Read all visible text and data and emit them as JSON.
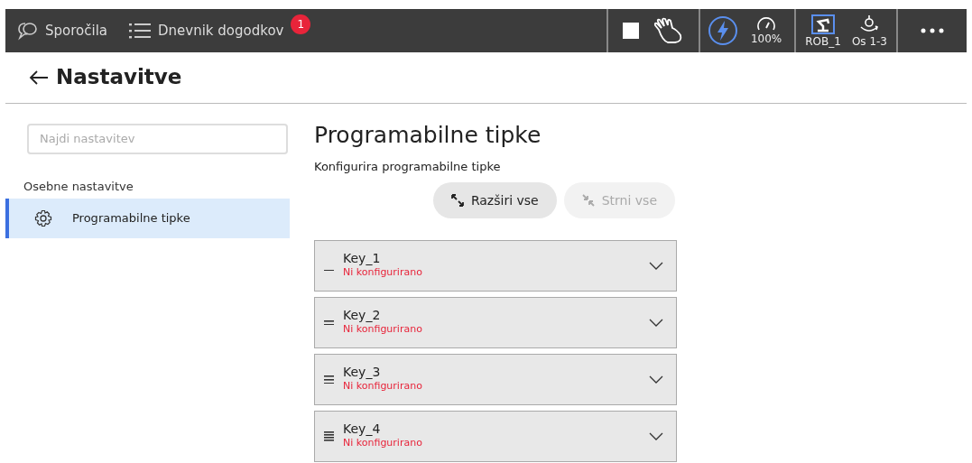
{
  "top_bar": {
    "messages": {
      "label": "Sporočila"
    },
    "event_log": {
      "label": "Dnevnik dogodkov",
      "badge": "1"
    },
    "speed": {
      "reading": "100%"
    },
    "robot": {
      "label": "ROB_1"
    },
    "axes": {
      "label": "Os 1-3"
    }
  },
  "page": {
    "title": "Nastavitve"
  },
  "sidebar": {
    "search": {
      "placeholder": "Najdi nastavitev"
    },
    "section": "Osebne nastavitve",
    "items": [
      {
        "label": "Programabilne tipke",
        "selected": true
      }
    ]
  },
  "content": {
    "title": "Programabilne tipke",
    "subtitle": "Konfigurira programabilne tipke",
    "buttons": [
      {
        "kind": "expand",
        "label": "Razširi vse",
        "disabled": false
      },
      {
        "kind": "collapse",
        "label": "Strni vse",
        "disabled": true
      }
    ],
    "keys": [
      {
        "kind": "single",
        "name": "Key_1",
        "status": "Ni konfigurirano",
        "expanded": false
      },
      {
        "kind": "double",
        "name": "Key_2",
        "status": "Ni konfigurirano",
        "expanded": false
      },
      {
        "kind": "triple",
        "name": "Key_3",
        "status": "Ni konfigurirano",
        "expanded": false
      },
      {
        "kind": "quadruple",
        "name": "Key_4",
        "status": "Ni konfigurirano",
        "expanded": false
      }
    ]
  }
}
